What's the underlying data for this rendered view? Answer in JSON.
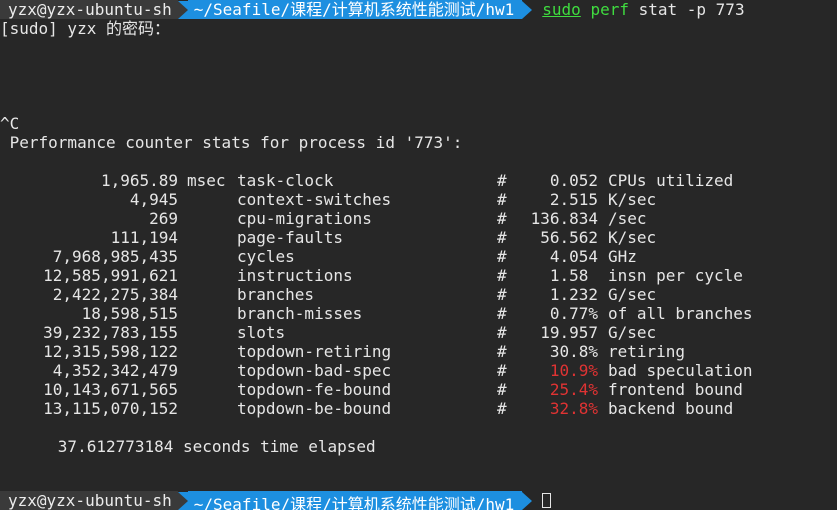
{
  "prompt": {
    "user_host": "yzx@yzx-ubuntu-sh",
    "path": "~/Seafile/课程/计算机系统性能测试/hw1",
    "cmd_sudo": "sudo",
    "cmd_perf": "perf",
    "cmd_args": "stat -p 773"
  },
  "sudo_prompt": "[sudo] yzx 的密码：",
  "interrupt": "^C",
  "header": " Performance counter stats for process id '773':",
  "stats": [
    {
      "value": "1,965.89",
      "unit": "msec",
      "event": "task-clock",
      "hash": "#",
      "metric": "0.052",
      "metric_text": "CPUs utilized",
      "highlight": false
    },
    {
      "value": "4,945",
      "unit": "",
      "event": "context-switches",
      "hash": "#",
      "metric": "2.515",
      "metric_text": "K/sec",
      "highlight": false
    },
    {
      "value": "269",
      "unit": "",
      "event": "cpu-migrations",
      "hash": "#",
      "metric": "136.834",
      "metric_text": "/sec",
      "highlight": false
    },
    {
      "value": "111,194",
      "unit": "",
      "event": "page-faults",
      "hash": "#",
      "metric": "56.562",
      "metric_text": "K/sec",
      "highlight": false
    },
    {
      "value": "7,968,985,435",
      "unit": "",
      "event": "cycles",
      "hash": "#",
      "metric": "4.054",
      "metric_text": "GHz",
      "highlight": false
    },
    {
      "value": "12,585,991,621",
      "unit": "",
      "event": "instructions",
      "hash": "#",
      "metric": "1.58 ",
      "metric_text": "insn per cycle",
      "highlight": false
    },
    {
      "value": "2,422,275,384",
      "unit": "",
      "event": "branches",
      "hash": "#",
      "metric": "1.232",
      "metric_text": "G/sec",
      "highlight": false
    },
    {
      "value": "18,598,515",
      "unit": "",
      "event": "branch-misses",
      "hash": "#",
      "metric": "0.77%",
      "metric_text": "of all branches",
      "highlight": false
    },
    {
      "value": "39,232,783,155",
      "unit": "",
      "event": "slots",
      "hash": "#",
      "metric": "19.957",
      "metric_text": "G/sec",
      "highlight": false
    },
    {
      "value": "12,315,598,122",
      "unit": "",
      "event": "topdown-retiring",
      "hash": "#",
      "metric": "30.8%",
      "metric_text": "retiring",
      "highlight": false
    },
    {
      "value": "4,352,342,479",
      "unit": "",
      "event": "topdown-bad-spec",
      "hash": "#",
      "metric": "10.9%",
      "metric_text": "bad speculation",
      "highlight": true
    },
    {
      "value": "10,143,671,565",
      "unit": "",
      "event": "topdown-fe-bound",
      "hash": "#",
      "metric": "25.4%",
      "metric_text": "frontend bound",
      "highlight": true
    },
    {
      "value": "13,115,070,152",
      "unit": "",
      "event": "topdown-be-bound",
      "hash": "#",
      "metric": "32.8%",
      "metric_text": "backend bound",
      "highlight": true
    }
  ],
  "elapsed": "      37.612773184 seconds time elapsed",
  "colors": {
    "background": "#272727",
    "user_segment": "#3a3a3a",
    "path_segment": "#1d8fe0",
    "command": "#3fdc3f",
    "highlight": "#e03333"
  }
}
